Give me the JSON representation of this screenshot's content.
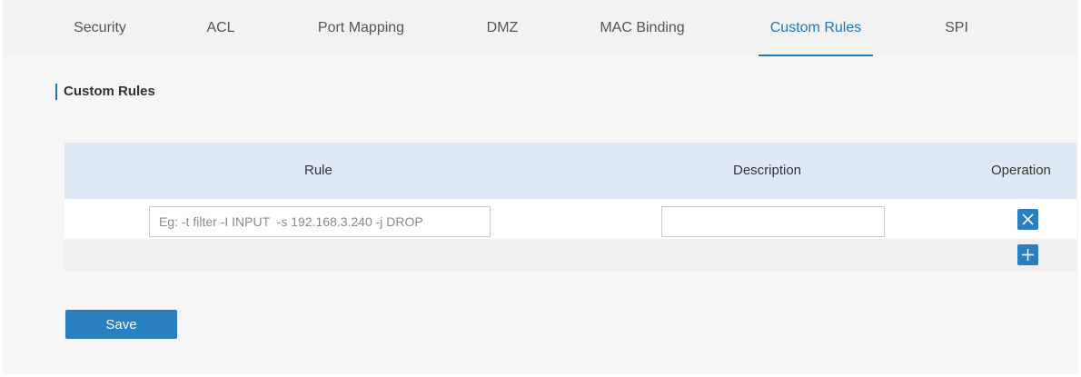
{
  "tabs": [
    {
      "label": "Security",
      "active": false
    },
    {
      "label": "ACL",
      "active": false
    },
    {
      "label": "Port Mapping",
      "active": false
    },
    {
      "label": "DMZ",
      "active": false
    },
    {
      "label": "MAC Binding",
      "active": false
    },
    {
      "label": "Custom Rules",
      "active": true
    },
    {
      "label": "SPI",
      "active": false
    }
  ],
  "section": {
    "title": "Custom Rules"
  },
  "table": {
    "headers": {
      "rule": "Rule",
      "description": "Description",
      "operation": "Operation"
    },
    "rows": [
      {
        "rule_value": "",
        "rule_placeholder": "Eg: -t filter -I INPUT  -s 192.168.3.240 -j DROP",
        "description_value": ""
      }
    ],
    "row_action_icon": "close-icon",
    "add_icon": "plus-icon"
  },
  "actions": {
    "save_label": "Save"
  },
  "colors": {
    "accent": "#1a7ab8",
    "button": "#2a7fc0",
    "header_bg": "#ddeaf5"
  }
}
